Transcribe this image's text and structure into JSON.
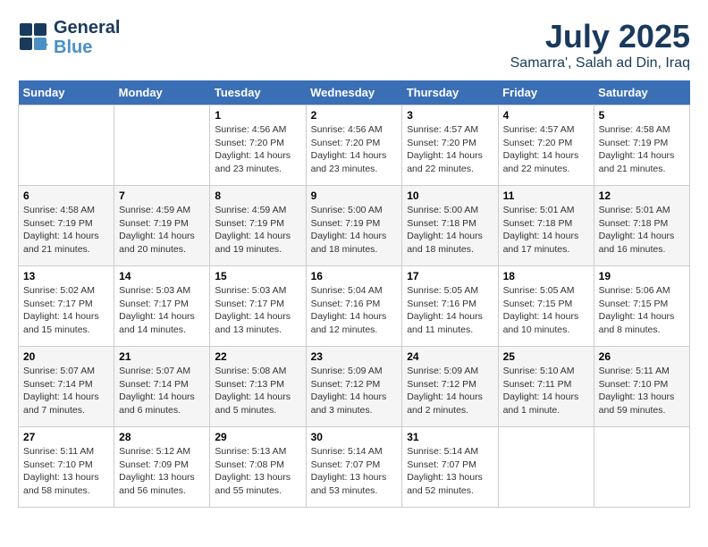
{
  "logo": {
    "line1": "General",
    "line2": "Blue"
  },
  "title": "July 2025",
  "subtitle": "Samarra', Salah ad Din, Iraq",
  "days_of_week": [
    "Sunday",
    "Monday",
    "Tuesday",
    "Wednesday",
    "Thursday",
    "Friday",
    "Saturday"
  ],
  "weeks": [
    [
      {
        "day": "",
        "info": ""
      },
      {
        "day": "",
        "info": ""
      },
      {
        "day": "1",
        "info": "Sunrise: 4:56 AM\nSunset: 7:20 PM\nDaylight: 14 hours and 23 minutes."
      },
      {
        "day": "2",
        "info": "Sunrise: 4:56 AM\nSunset: 7:20 PM\nDaylight: 14 hours and 23 minutes."
      },
      {
        "day": "3",
        "info": "Sunrise: 4:57 AM\nSunset: 7:20 PM\nDaylight: 14 hours and 22 minutes."
      },
      {
        "day": "4",
        "info": "Sunrise: 4:57 AM\nSunset: 7:20 PM\nDaylight: 14 hours and 22 minutes."
      },
      {
        "day": "5",
        "info": "Sunrise: 4:58 AM\nSunset: 7:19 PM\nDaylight: 14 hours and 21 minutes."
      }
    ],
    [
      {
        "day": "6",
        "info": "Sunrise: 4:58 AM\nSunset: 7:19 PM\nDaylight: 14 hours and 21 minutes."
      },
      {
        "day": "7",
        "info": "Sunrise: 4:59 AM\nSunset: 7:19 PM\nDaylight: 14 hours and 20 minutes."
      },
      {
        "day": "8",
        "info": "Sunrise: 4:59 AM\nSunset: 7:19 PM\nDaylight: 14 hours and 19 minutes."
      },
      {
        "day": "9",
        "info": "Sunrise: 5:00 AM\nSunset: 7:19 PM\nDaylight: 14 hours and 18 minutes."
      },
      {
        "day": "10",
        "info": "Sunrise: 5:00 AM\nSunset: 7:18 PM\nDaylight: 14 hours and 18 minutes."
      },
      {
        "day": "11",
        "info": "Sunrise: 5:01 AM\nSunset: 7:18 PM\nDaylight: 14 hours and 17 minutes."
      },
      {
        "day": "12",
        "info": "Sunrise: 5:01 AM\nSunset: 7:18 PM\nDaylight: 14 hours and 16 minutes."
      }
    ],
    [
      {
        "day": "13",
        "info": "Sunrise: 5:02 AM\nSunset: 7:17 PM\nDaylight: 14 hours and 15 minutes."
      },
      {
        "day": "14",
        "info": "Sunrise: 5:03 AM\nSunset: 7:17 PM\nDaylight: 14 hours and 14 minutes."
      },
      {
        "day": "15",
        "info": "Sunrise: 5:03 AM\nSunset: 7:17 PM\nDaylight: 14 hours and 13 minutes."
      },
      {
        "day": "16",
        "info": "Sunrise: 5:04 AM\nSunset: 7:16 PM\nDaylight: 14 hours and 12 minutes."
      },
      {
        "day": "17",
        "info": "Sunrise: 5:05 AM\nSunset: 7:16 PM\nDaylight: 14 hours and 11 minutes."
      },
      {
        "day": "18",
        "info": "Sunrise: 5:05 AM\nSunset: 7:15 PM\nDaylight: 14 hours and 10 minutes."
      },
      {
        "day": "19",
        "info": "Sunrise: 5:06 AM\nSunset: 7:15 PM\nDaylight: 14 hours and 8 minutes."
      }
    ],
    [
      {
        "day": "20",
        "info": "Sunrise: 5:07 AM\nSunset: 7:14 PM\nDaylight: 14 hours and 7 minutes."
      },
      {
        "day": "21",
        "info": "Sunrise: 5:07 AM\nSunset: 7:14 PM\nDaylight: 14 hours and 6 minutes."
      },
      {
        "day": "22",
        "info": "Sunrise: 5:08 AM\nSunset: 7:13 PM\nDaylight: 14 hours and 5 minutes."
      },
      {
        "day": "23",
        "info": "Sunrise: 5:09 AM\nSunset: 7:12 PM\nDaylight: 14 hours and 3 minutes."
      },
      {
        "day": "24",
        "info": "Sunrise: 5:09 AM\nSunset: 7:12 PM\nDaylight: 14 hours and 2 minutes."
      },
      {
        "day": "25",
        "info": "Sunrise: 5:10 AM\nSunset: 7:11 PM\nDaylight: 14 hours and 1 minute."
      },
      {
        "day": "26",
        "info": "Sunrise: 5:11 AM\nSunset: 7:10 PM\nDaylight: 13 hours and 59 minutes."
      }
    ],
    [
      {
        "day": "27",
        "info": "Sunrise: 5:11 AM\nSunset: 7:10 PM\nDaylight: 13 hours and 58 minutes."
      },
      {
        "day": "28",
        "info": "Sunrise: 5:12 AM\nSunset: 7:09 PM\nDaylight: 13 hours and 56 minutes."
      },
      {
        "day": "29",
        "info": "Sunrise: 5:13 AM\nSunset: 7:08 PM\nDaylight: 13 hours and 55 minutes."
      },
      {
        "day": "30",
        "info": "Sunrise: 5:14 AM\nSunset: 7:07 PM\nDaylight: 13 hours and 53 minutes."
      },
      {
        "day": "31",
        "info": "Sunrise: 5:14 AM\nSunset: 7:07 PM\nDaylight: 13 hours and 52 minutes."
      },
      {
        "day": "",
        "info": ""
      },
      {
        "day": "",
        "info": ""
      }
    ]
  ]
}
